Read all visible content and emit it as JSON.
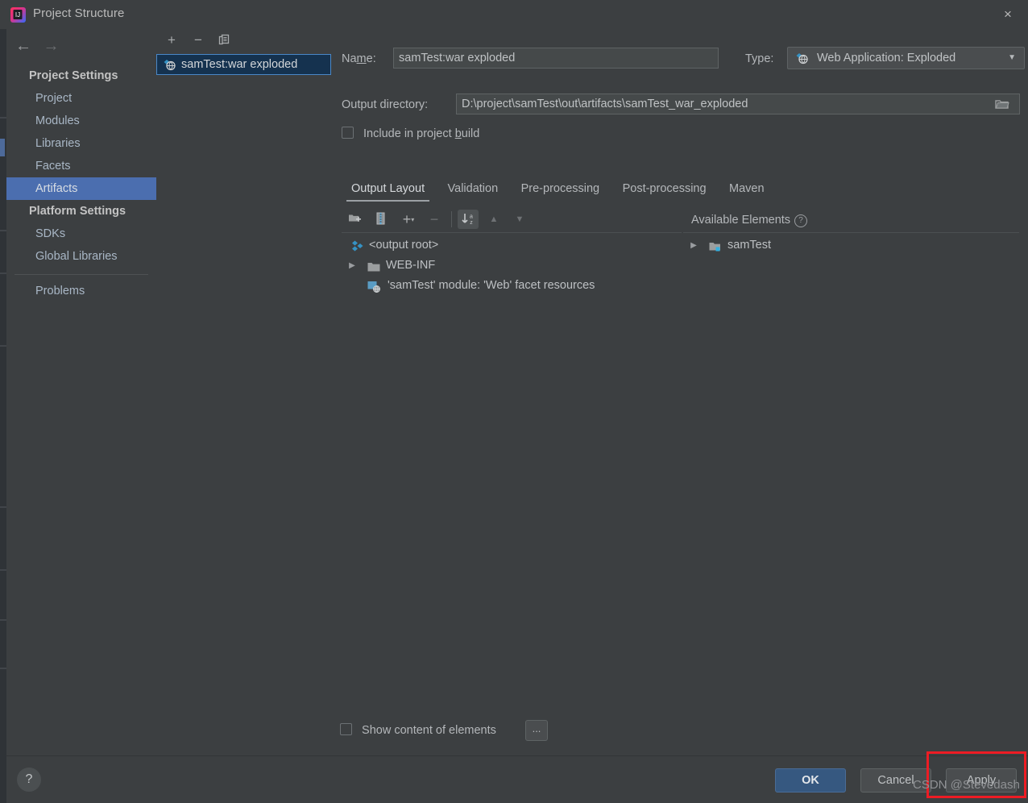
{
  "window": {
    "title": "Project Structure",
    "app_icon": "intellij-idea-icon",
    "close_icon": "×"
  },
  "nav": {
    "back_icon": "←",
    "forward_icon": "→"
  },
  "sidebar": {
    "groups": [
      {
        "header": "Project Settings",
        "items": [
          {
            "label": "Project",
            "selected": false
          },
          {
            "label": "Modules",
            "selected": false
          },
          {
            "label": "Libraries",
            "selected": false
          },
          {
            "label": "Facets",
            "selected": false
          },
          {
            "label": "Artifacts",
            "selected": true
          }
        ]
      },
      {
        "header": "Platform Settings",
        "items": [
          {
            "label": "SDKs",
            "selected": false
          },
          {
            "label": "Global Libraries",
            "selected": false
          }
        ]
      }
    ],
    "problems": "Problems"
  },
  "artifacts_panel": {
    "toolbar": [
      {
        "name": "add-artifact-button",
        "glyph": "+"
      },
      {
        "name": "remove-artifact-button",
        "glyph": "−"
      },
      {
        "name": "copy-artifact-button",
        "glyph": "copy-icon"
      }
    ],
    "items": [
      {
        "label": "samTest:war exploded",
        "icon": "war-exploded-icon",
        "selected": true
      }
    ]
  },
  "form": {
    "name_label": "Name:",
    "name_value": "samTest:war exploded",
    "type_label": "Type:",
    "type_value": "Web Application: Exploded",
    "type_icon": "war-exploded-icon",
    "output_label": "Output directory:",
    "output_value": "D:\\project\\samTest\\out\\artifacts\\samTest_war_exploded",
    "browse_icon": "folder-icon",
    "include_in_build_label": "Include in project build",
    "include_in_build_checked": false
  },
  "tabs": [
    {
      "label": "Output Layout",
      "active": true
    },
    {
      "label": "Validation",
      "active": false
    },
    {
      "label": "Pre-processing",
      "active": false
    },
    {
      "label": "Post-processing",
      "active": false
    },
    {
      "label": "Maven",
      "active": false
    }
  ],
  "layout_toolbar": {
    "buttons": [
      {
        "name": "add-directory-button",
        "icon": "new-folder-icon",
        "state": "enabled"
      },
      {
        "name": "add-archive-button",
        "icon": "archive-icon",
        "state": "enabled"
      },
      {
        "name": "add-element-button",
        "icon": "plus-dropdown-icon",
        "state": "enabled"
      },
      {
        "name": "remove-element-button",
        "icon": "minus-icon",
        "state": "disabled"
      },
      {
        "name": "sort-button",
        "icon": "sort-az-icon",
        "state": "pressed"
      },
      {
        "name": "move-up-button",
        "icon": "arrow-up-icon",
        "state": "disabled"
      },
      {
        "name": "move-down-button",
        "icon": "arrow-down-icon",
        "state": "disabled"
      }
    ],
    "available_elements_label": "Available Elements",
    "available_help_icon": "?"
  },
  "output_tree": [
    {
      "label": "<output root>",
      "icon": "output-root-icon",
      "indent": 0,
      "twisty": ""
    },
    {
      "label": "WEB-INF",
      "icon": "folder-icon",
      "indent": 0,
      "twisty": "▶"
    },
    {
      "label": "'samTest' module: 'Web' facet resources",
      "icon": "facet-resource-icon",
      "indent": 1,
      "twisty": ""
    }
  ],
  "available_tree": [
    {
      "label": "samTest",
      "icon": "module-icon",
      "indent": 0,
      "twisty": "▶"
    }
  ],
  "bottom": {
    "show_content_label": "Show content of elements",
    "show_content_checked": false,
    "ellipsis_label": "...",
    "help_glyph": "?",
    "ok_label": "OK",
    "cancel_label": "Cancel",
    "apply_label": "Apply"
  },
  "annotation": {
    "watermark": "CSDN @Stevedash",
    "highlight_color": "#ed1c24",
    "highlight_target": "apply-button"
  }
}
